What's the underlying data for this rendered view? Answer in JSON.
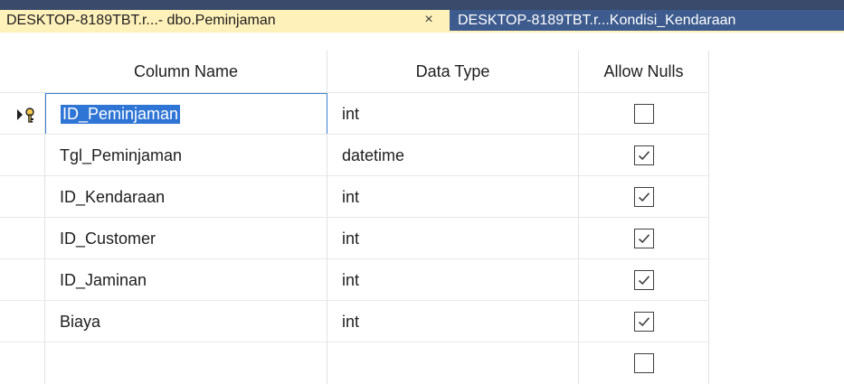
{
  "tabs": [
    {
      "label": "DESKTOP-8189TBT.r...- dbo.Peminjaman",
      "active": true,
      "close": "×"
    },
    {
      "label": "DESKTOP-8189TBT.r...Kondisi_Kendaraan",
      "active": false
    }
  ],
  "columns": {
    "name": "Column Name",
    "type": "Data Type",
    "nulls": "Allow Nulls"
  },
  "rows": [
    {
      "name": "ID_Peminjaman",
      "type": "int",
      "allow_nulls": false
    },
    {
      "name": "Tgl_Peminjaman",
      "type": "datetime",
      "allow_nulls": true
    },
    {
      "name": "ID_Kendaraan",
      "type": "int",
      "allow_nulls": true
    },
    {
      "name": "ID_Customer",
      "type": "int",
      "allow_nulls": true
    },
    {
      "name": "ID_Jaminan",
      "type": "int",
      "allow_nulls": true
    },
    {
      "name": "Biaya",
      "type": "int",
      "allow_nulls": true
    },
    {
      "name": "",
      "type": "",
      "allow_nulls": false
    }
  ],
  "icons": {
    "row_indicator": "current-row-arrow-icon",
    "primary_key": "primary-key-icon"
  },
  "colors": {
    "active_tab": "#fff1ba",
    "inactive_tab": "#3d5b8d",
    "selection": "#2f75d6"
  }
}
